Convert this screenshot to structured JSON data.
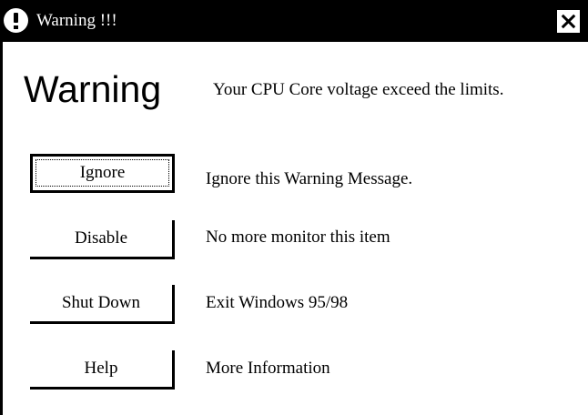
{
  "window": {
    "title": "Warning !!!",
    "icon": "exclamation-icon",
    "close_icon": "close-icon"
  },
  "main": {
    "heading": "Warning",
    "message": "Your CPU Core voltage exceed the limits."
  },
  "actions": [
    {
      "label": "Ignore",
      "description": "Ignore this Warning Message.",
      "is_default": true
    },
    {
      "label": "Disable",
      "description": "No more monitor this item",
      "is_default": false
    },
    {
      "label": "Shut Down",
      "description": "Exit Windows 95/98",
      "is_default": false
    },
    {
      "label": "Help",
      "description": "More Information",
      "is_default": false
    }
  ],
  "colors": {
    "titlebar": "#000000",
    "background": "#ffffff",
    "text": "#000000"
  }
}
